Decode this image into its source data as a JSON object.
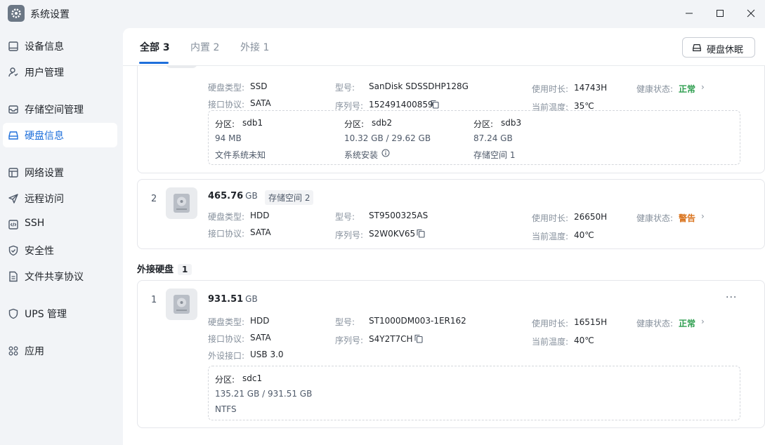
{
  "window": {
    "title": "系统设置"
  },
  "sidebar": {
    "items": [
      {
        "label": "设备信息",
        "icon": "device-icon"
      },
      {
        "label": "用户管理",
        "icon": "user-icon"
      },
      {
        "label": "存储空间管理",
        "icon": "storage-icon"
      },
      {
        "label": "硬盘信息",
        "icon": "disk-icon"
      },
      {
        "label": "网络设置",
        "icon": "network-icon"
      },
      {
        "label": "远程访问",
        "icon": "send-icon"
      },
      {
        "label": "SSH",
        "icon": "code-icon"
      },
      {
        "label": "安全性",
        "icon": "shield-icon"
      },
      {
        "label": "文件共享协议",
        "icon": "file-icon"
      },
      {
        "label": "UPS 管理",
        "icon": "ups-shield-icon"
      },
      {
        "label": "应用",
        "icon": "apps-icon"
      }
    ]
  },
  "tabs": [
    {
      "label": "全部 3"
    },
    {
      "label": "内置 2"
    },
    {
      "label": "外接 1"
    }
  ],
  "toolbar": {
    "sleep_label": "硬盘休眠"
  },
  "labels": {
    "type": "硬盘类型:",
    "iface": "接口协议:",
    "model": "型号:",
    "serial": "序列号:",
    "hours": "使用时长:",
    "temp": "当前温度:",
    "health": "健康状态:",
    "partition": "分区:",
    "ext_port": "外设接口:"
  },
  "disk1": {
    "type": "SSD",
    "iface": "SATA",
    "model": "SanDisk SDSSDHP128G",
    "serial": "152491400859",
    "hours": "14743H",
    "temp": "35℃",
    "health": "正常",
    "partitions": [
      {
        "name": "sdb1",
        "size": "94 MB",
        "fs": "文件系统未知"
      },
      {
        "name": "sdb2",
        "size": "10.32 GB / 29.62 GB",
        "fs": "系统安装"
      },
      {
        "name": "sdb3",
        "size": "87.24 GB",
        "fs": "存储空间 1"
      }
    ]
  },
  "disk2": {
    "index": "2",
    "capacity": "465.76",
    "unit": "GB",
    "pool": "存储空间 2",
    "type": "HDD",
    "iface": "SATA",
    "model": "ST9500325AS",
    "serial": "S2W0KV65",
    "hours": "26650H",
    "temp": "40℃",
    "health": "警告"
  },
  "external": {
    "title": "外接硬盘",
    "count": "1"
  },
  "disk3": {
    "index": "1",
    "capacity": "931.51",
    "unit": "GB",
    "type": "HDD",
    "iface": "SATA",
    "ext_port": "USB 3.0",
    "model": "ST1000DM003-1ER162",
    "serial": "S4Y2T7CH",
    "hours": "16515H",
    "temp": "40℃",
    "health": "正常",
    "partitions": [
      {
        "name": "sdc1",
        "size": "135.21 GB / 931.51 GB",
        "fs": "NTFS"
      }
    ]
  },
  "colors": {
    "accent": "#1e6fdb",
    "ok": "#2e9e4f",
    "warn": "#d9731d"
  }
}
